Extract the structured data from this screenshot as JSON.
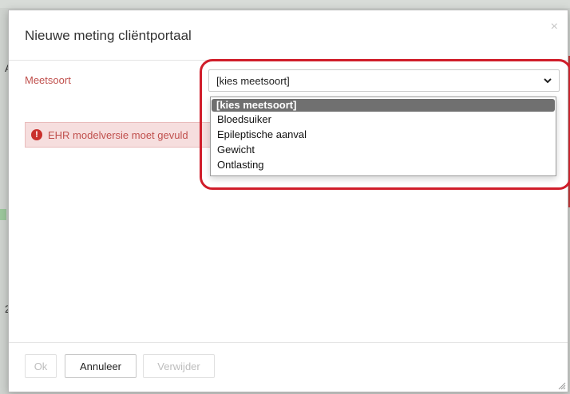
{
  "background": {
    "left_marks": [
      "A",
      "2"
    ]
  },
  "dialog": {
    "title": "Nieuwe meting cliëntportaal",
    "close_symbol": "×"
  },
  "form": {
    "meetsoort_label": "Meetsoort",
    "select": {
      "selected_value": "[kies meetsoort]",
      "options": [
        "[kies meetsoort]",
        "Bloedsuiker",
        "Epileptische aanval",
        "Gewicht",
        "Ontlasting"
      ],
      "highlighted_index": 0
    },
    "alert": {
      "icon_symbol": "!",
      "text": "EHR modelversie moet gevuld"
    }
  },
  "footer": {
    "ok_label": "Ok",
    "cancel_label": "Annuleer",
    "delete_label": "Verwijder"
  },
  "colors": {
    "label_red": "#c0504d",
    "highlight_ring": "#d01d2a",
    "selected_option_bg": "#707070",
    "alert_bg": "#f6dede"
  },
  "icons": {
    "close": "close-icon",
    "dropdown": "chevron-down-icon",
    "alert": "exclamation-circle-icon",
    "resize": "resize-handle-icon"
  }
}
